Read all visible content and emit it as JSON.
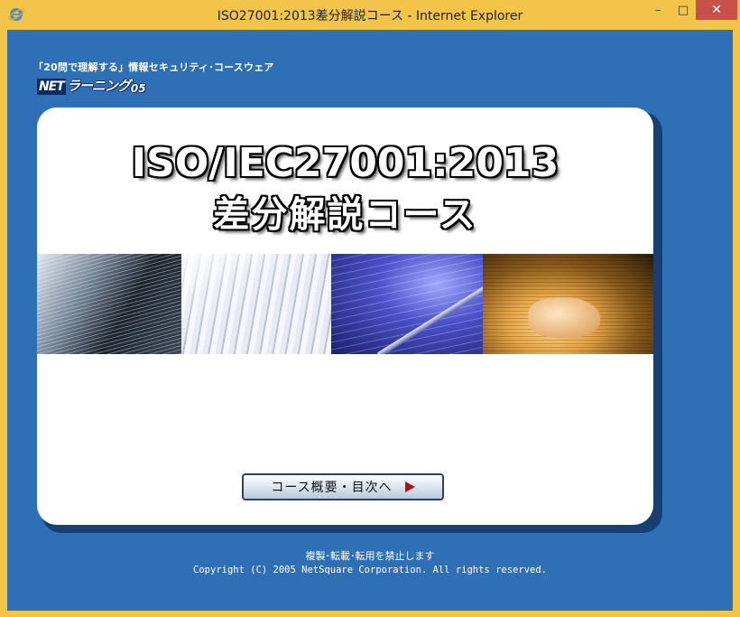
{
  "window": {
    "title": "ISO27001:2013差分解説コース - Internet Explorer",
    "minimize_label": "–",
    "maximize_label": "□",
    "close_label": "✕"
  },
  "header": {
    "tagline": "「20問で理解する」情報セキュリティ･コースウェア",
    "logo_net": "NET",
    "logo_main": "ラーニング",
    "logo_num": "05"
  },
  "card": {
    "heading_line1": "ISO/IEC27001:2013",
    "heading_line2": "差分解説コース",
    "cta_label": "コース概要・目次へ"
  },
  "footer": {
    "notice": "複製･転載･転用を禁止します",
    "copyright": "Copyright (C) 2005  NetSquare Corporation. All rights reserved."
  },
  "colors": {
    "window_frame": "#f3c44a",
    "client_bg": "#2e6fb5",
    "card_bg": "#ffffff",
    "close_button": "#c7504a",
    "cta_arrow": "#b0101a"
  },
  "icons": {
    "app_icon": "internet-explorer-icon",
    "cta_arrow": "triangle-right-icon"
  }
}
